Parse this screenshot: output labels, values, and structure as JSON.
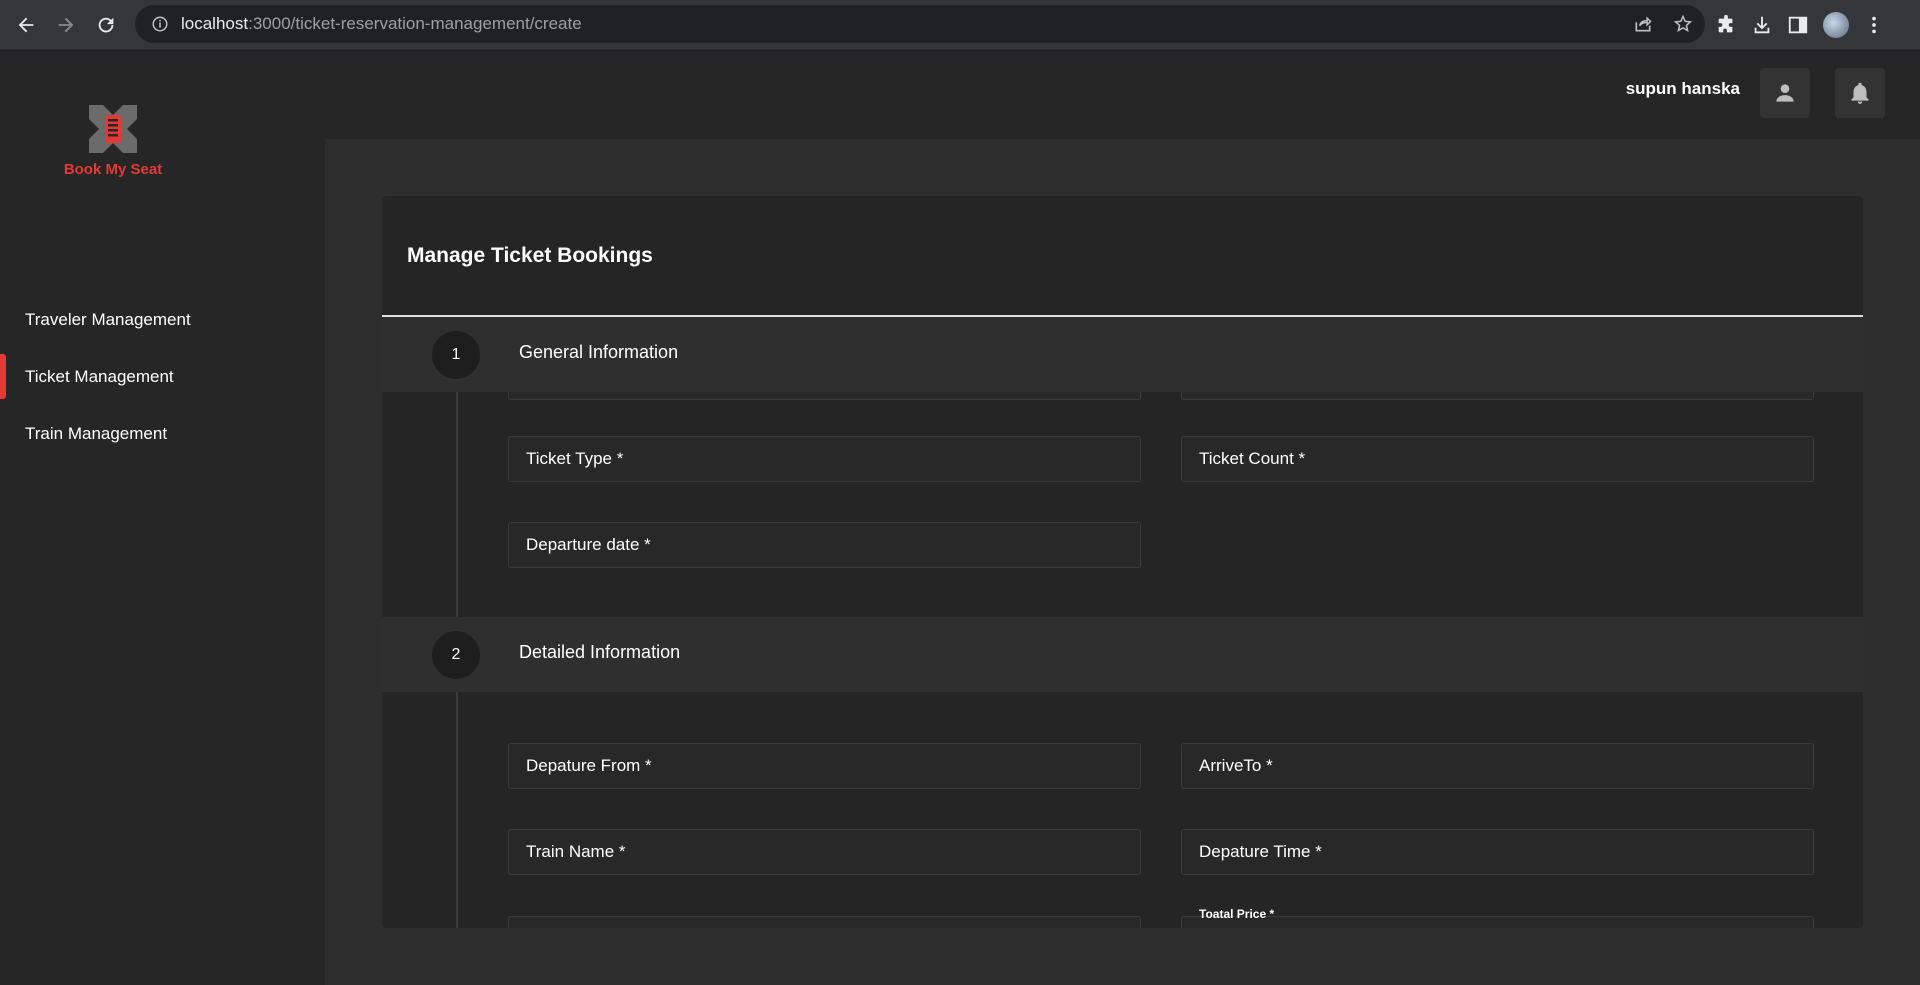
{
  "browser": {
    "url_host": "localhost",
    "url_path": ":3000/ticket-reservation-management/create"
  },
  "app": {
    "brand": "Book My Seat",
    "brand_color": "#e53935",
    "user_name": "supun hanska"
  },
  "sidebar": {
    "items": [
      {
        "label": "Traveler Management",
        "active": false
      },
      {
        "label": "Ticket Management",
        "active": true
      },
      {
        "label": "Train Management",
        "active": false
      }
    ]
  },
  "card": {
    "title": "Manage Ticket Bookings"
  },
  "steps": [
    {
      "number": "1",
      "label": "General Information",
      "fields": [
        "Ticket Type *",
        "Ticket Count *",
        "Departure date *"
      ]
    },
    {
      "number": "2",
      "label": "Detailed Information",
      "fields": [
        "Depature From *",
        "ArriveTo *",
        "Train Name *",
        "Depature Time *"
      ],
      "partial_field_label": "Toatal Price *"
    }
  ]
}
